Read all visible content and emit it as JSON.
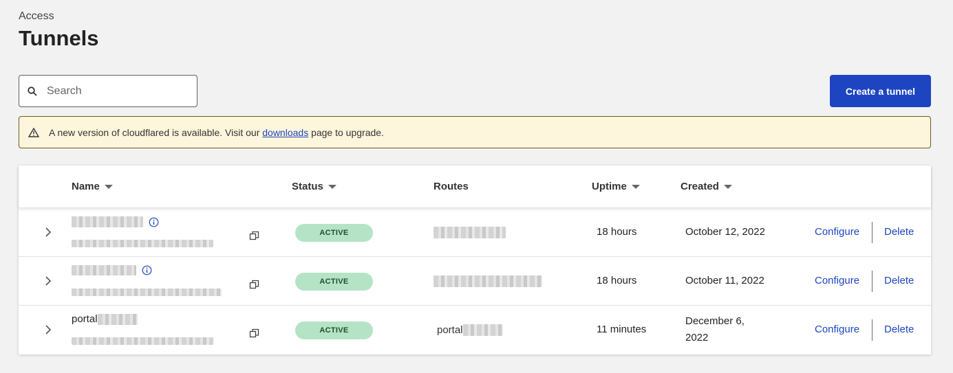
{
  "breadcrumb": "Access",
  "page_title": "Tunnels",
  "search": {
    "placeholder": "Search",
    "value": ""
  },
  "create_button": "Create a tunnel",
  "notice": {
    "prefix": "A new version of cloudflared is available. Visit our",
    "link": "downloads",
    "suffix": "page to upgrade."
  },
  "table": {
    "columns": {
      "name": "Name",
      "status": "Status",
      "routes": "Routes",
      "uptime": "Uptime",
      "created": "Created"
    },
    "rows": [
      {
        "name": "",
        "route": "",
        "status": "ACTIVE",
        "uptime": "18 hours",
        "created": "October 12, 2022",
        "configure": "Configure",
        "delete": "Delete"
      },
      {
        "name": "",
        "route": "",
        "status": "ACTIVE",
        "uptime": "18 hours",
        "created": "October 11, 2022",
        "configure": "Configure",
        "delete": "Delete"
      },
      {
        "name": "portal",
        "route": "portal",
        "status": "ACTIVE",
        "uptime": "11 minutes",
        "created": "December 6, 2022",
        "configure": "Configure",
        "delete": "Delete"
      }
    ]
  },
  "colors": {
    "accent": "#1d45c2",
    "active_badge": "#b5e3c6",
    "notice_bg": "#fdf6dd"
  },
  "icons": {
    "search": "search-icon",
    "warning": "warning-icon",
    "info": "info-icon",
    "copy": "copy-icon",
    "expand": "chevron-right-icon",
    "sort": "sort-down-icon"
  }
}
